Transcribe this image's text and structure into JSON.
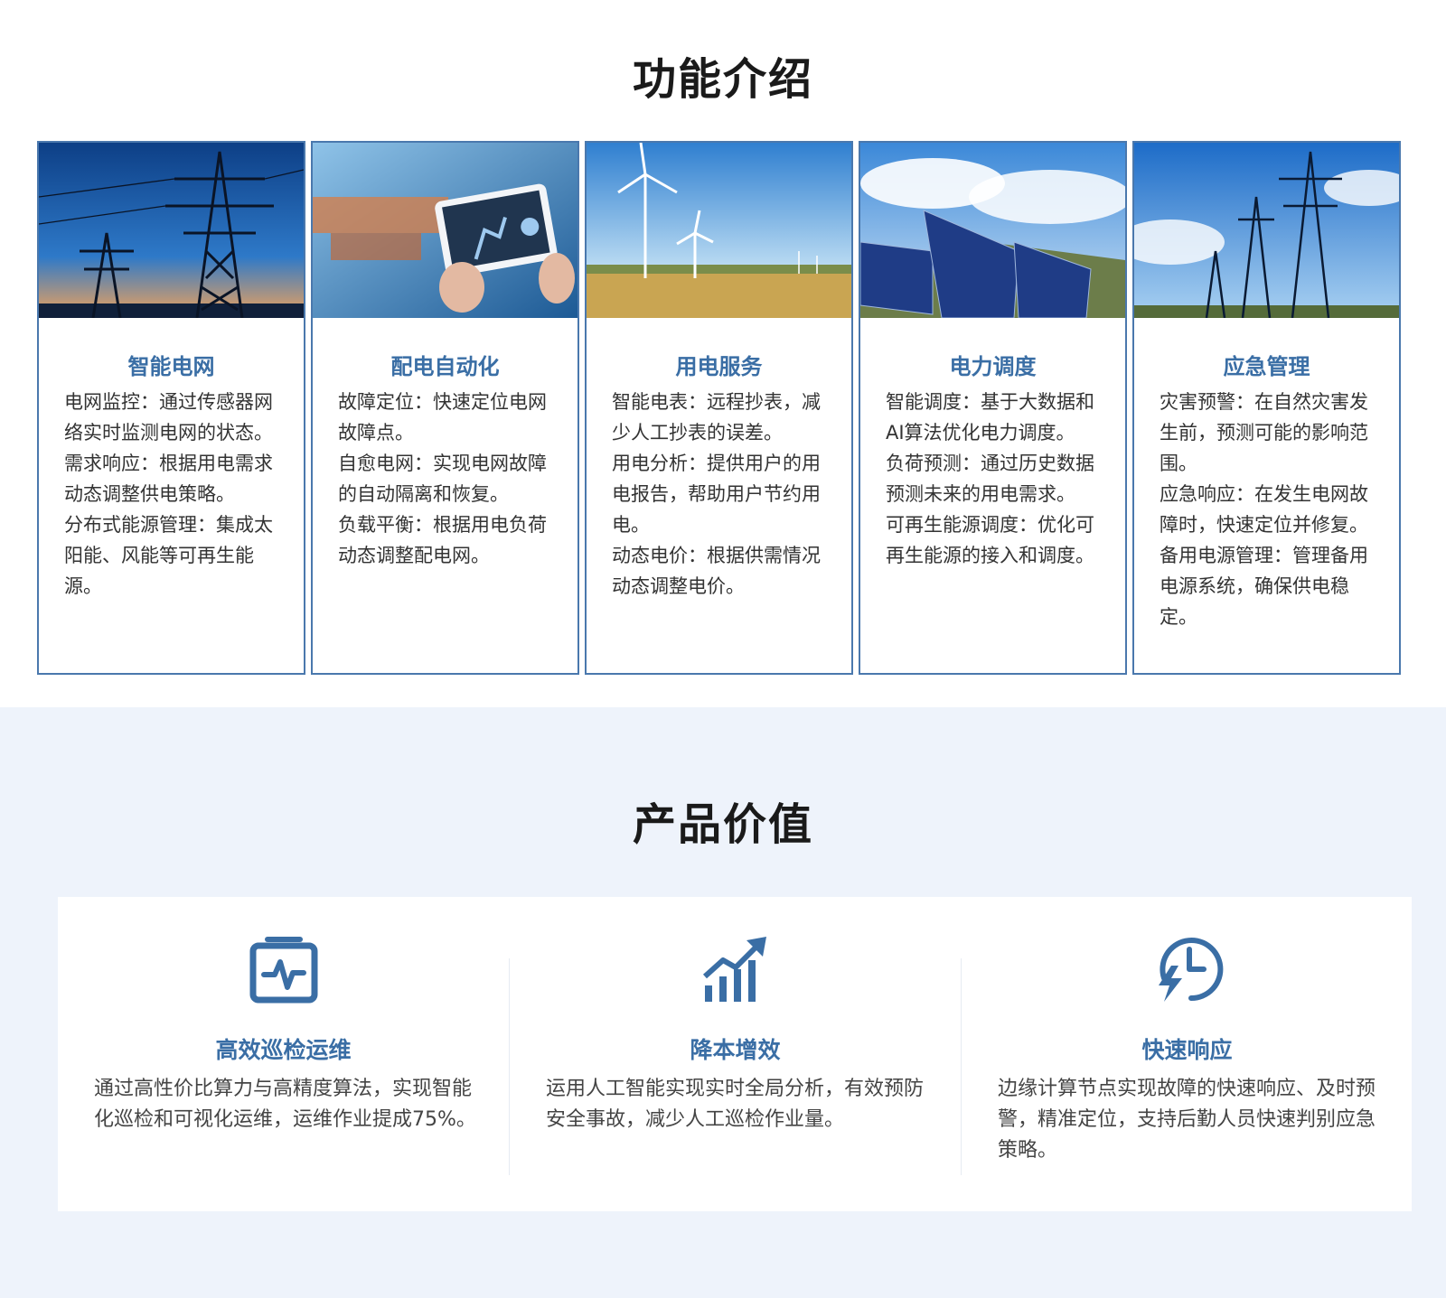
{
  "features": {
    "title": "功能介绍",
    "cards": [
      {
        "image": "transmission-tower-sunset",
        "title": "智能电网",
        "lines": [
          "电网监控：通过传感器网络实时监测电网的状态。",
          "需求响应：根据用电需求动态调整供电策略。",
          "分布式能源管理：集成太阳能、风能等可再生能源。"
        ]
      },
      {
        "image": "tablet-robot-automation",
        "title": "配电自动化",
        "lines": [
          "故障定位：快速定位电网故障点。",
          "自愈电网：实现电网故障的自动隔离和恢复。",
          "负载平衡：根据用电负荷动态调整配电网。"
        ]
      },
      {
        "image": "wind-turbines-field",
        "title": "用电服务",
        "lines": [
          "智能电表：远程抄表，减少人工抄表的误差。",
          "用电分析：提供用户的用电报告，帮助用户节约用电。",
          "动态电价：根据供需情况动态调整电价。"
        ]
      },
      {
        "image": "solar-panels-sky",
        "title": "电力调度",
        "lines": [
          "智能调度：基于大数据和AI算法优化电力调度。",
          "负荷预测：通过历史数据预测未来的用电需求。",
          "可再生能源调度：优化可再生能源的接入和调度。"
        ]
      },
      {
        "image": "power-line-towers-sky",
        "title": "应急管理",
        "lines": [
          "灾害预警：在自然灾害发生前，预测可能的影响范围。",
          "应急响应：在发生电网故障时，快速定位并修复。",
          "备用电源管理：管理备用电源系统，确保供电稳定。"
        ]
      }
    ]
  },
  "values": {
    "title": "产品价值",
    "items": [
      {
        "icon": "monitor-pulse-icon",
        "title": "高效巡检运维",
        "text": "通过高性价比算力与高精度算法，实现智能化巡检和可视化运维，运维作业提成75%。"
      },
      {
        "icon": "growth-chart-icon",
        "title": "降本增效",
        "text": "运用人工智能实现实时全局分析，有效预防安全事故，减少人工巡检作业量。"
      },
      {
        "icon": "clock-lightning-icon",
        "title": "快速响应",
        "text": "边缘计算节点实现故障的快速响应、及时预警，精准定位，支持后勤人员快速判别应急策略。"
      }
    ]
  },
  "colors": {
    "accent": "#3a6ea5",
    "border": "#4a78ad",
    "bg_light": "#eef3fb"
  }
}
